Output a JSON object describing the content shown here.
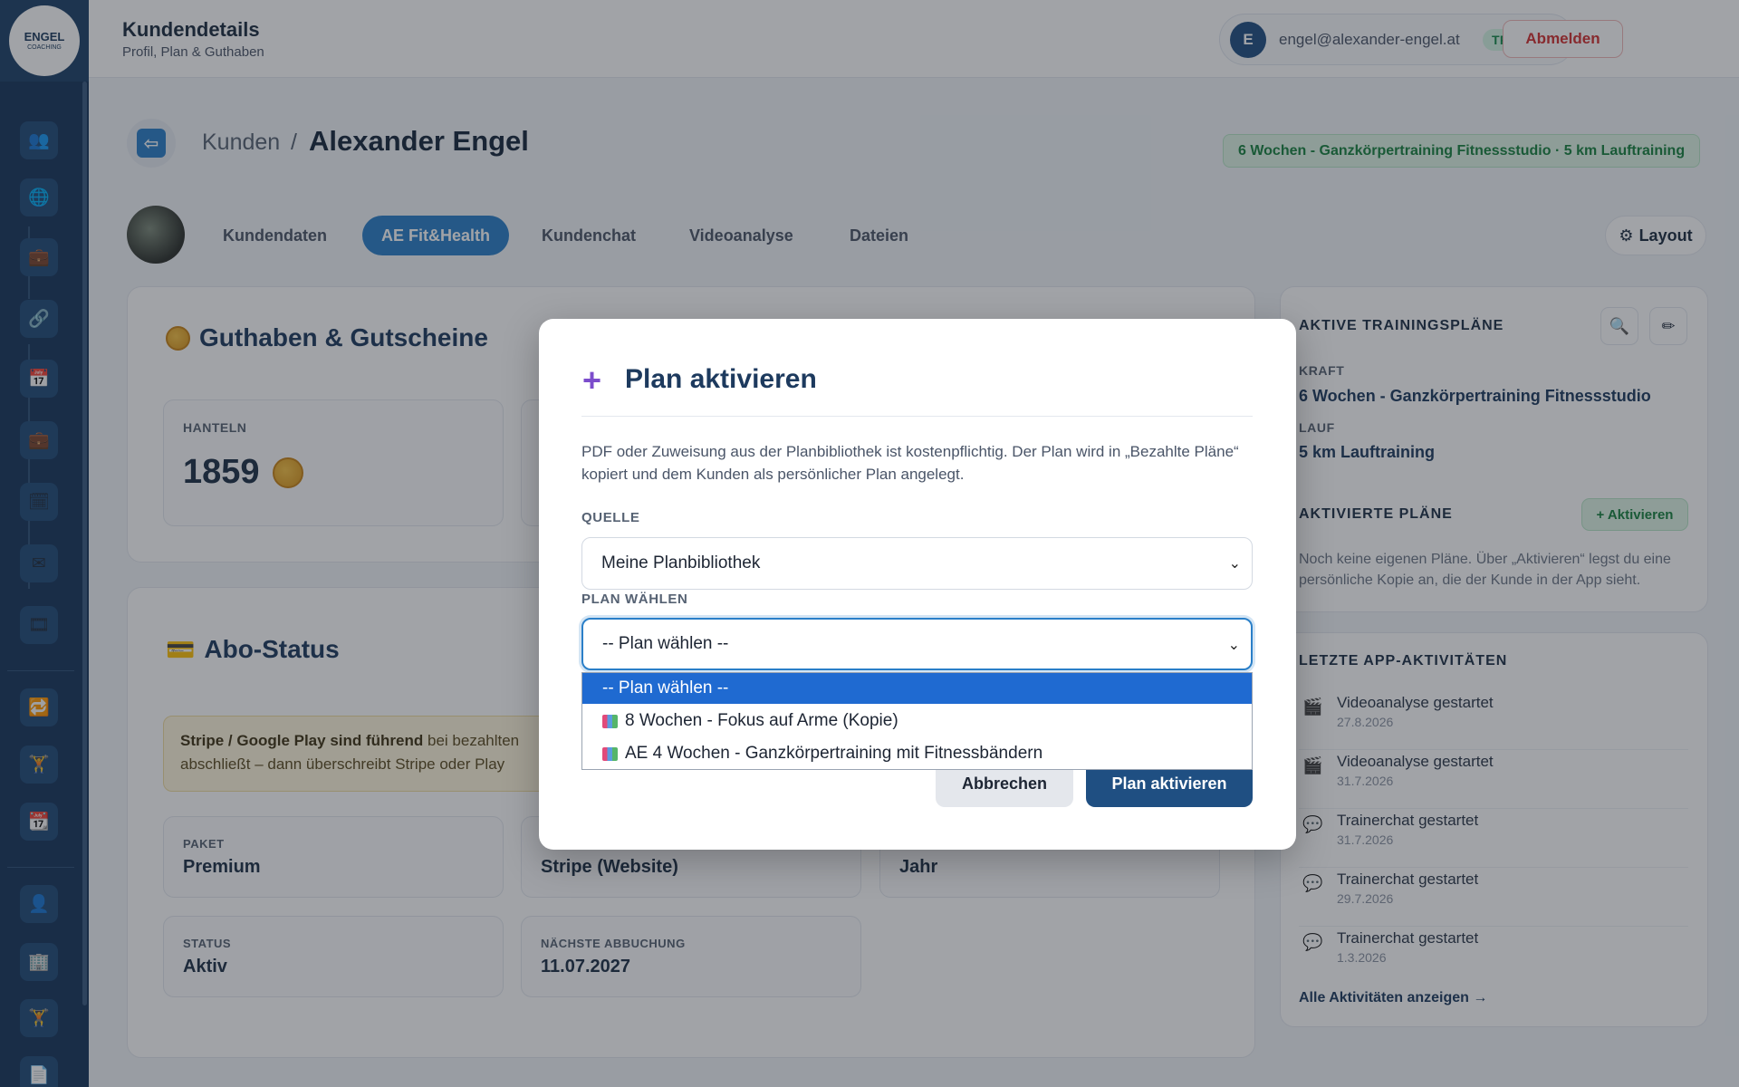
{
  "logo": {
    "line1": "ENGEL",
    "line2": "COACHING"
  },
  "header": {
    "title": "Kundendetails",
    "subtitle": "Profil, Plan & Guthaben",
    "user_initial": "E",
    "user_email": "engel@alexander-engel.at",
    "role_badge": "TRAINER",
    "logout_label": "Abmelden"
  },
  "breadcrumb": {
    "parent": "Kunden",
    "separator": "/",
    "current": "Alexander Engel"
  },
  "active_plan_pill": "6 Wochen - Ganzkörpertraining Fitnessstudio · 5 km Lauftraining",
  "tabs": [
    {
      "label": "Kundendaten"
    },
    {
      "label": "AE Fit&Health",
      "active": true
    },
    {
      "label": "Kundenchat"
    },
    {
      "label": "Videoanalyse"
    },
    {
      "label": "Dateien"
    }
  ],
  "layout_btn": "Layout",
  "credits": {
    "title": "Guthaben & Gutscheine",
    "box_label": "HANTELN",
    "box_value": "1859"
  },
  "abo": {
    "title": "Abo-Status",
    "note_bold": "Stripe / Google Play sind führend",
    "note_line1": "bei bezahlten",
    "note_line2": "abschließt – dann überschreibt Stripe oder Play",
    "paket_label": "PAKET",
    "paket_value": "Premium",
    "quelle_value": "Stripe (Website)",
    "intervall_value": "Jahr",
    "status_label": "STATUS",
    "status_value": "Aktiv",
    "next_label": "NÄCHSTE ABBUCHUNG",
    "next_value": "11.07.2027"
  },
  "right": {
    "active_plans_title": "AKTIVE TRAININGSPLÄNE",
    "kraft_label": "KRAFT",
    "kraft_value": "6 Wochen - Ganzkörpertraining Fitnessstudio",
    "lauf_label": "LAUF",
    "lauf_value": "5 km Lauftraining",
    "activated_title": "AKTIVIERTE PLÄNE",
    "activate_btn": "+ Aktivieren",
    "activated_text": "Noch keine eigenen Pläne. Über „Aktivieren“ legst du eine persönliche Kopie an, die der Kunde in der App sieht.",
    "activities_title": "LETZTE APP-AKTIVITÄTEN",
    "activities": [
      {
        "name": "Videoanalyse gestartet",
        "date": "27.8.2026",
        "icon": "clapper-icon"
      },
      {
        "name": "Videoanalyse gestartet",
        "date": "31.7.2026",
        "icon": "clapper-icon"
      },
      {
        "name": "Trainerchat gestartet",
        "date": "31.7.2026",
        "icon": "chat-icon"
      },
      {
        "name": "Trainerchat gestartet",
        "date": "29.7.2026",
        "icon": "chat-icon"
      },
      {
        "name": "Trainerchat gestartet",
        "date": "1.3.2026",
        "icon": "chat-icon"
      }
    ],
    "all_activities": "Alle Aktivitäten anzeigen →"
  },
  "modal": {
    "title": "Plan aktivieren",
    "description": "PDF oder Zuweisung aus der Planbibliothek ist kostenpflichtig. Der Plan wird in „Bezahlte Pläne“ kopiert und dem Kunden als persönlicher Plan angelegt.",
    "source_label": "QUELLE",
    "source_value": "Meine Planbibliothek",
    "plan_label": "PLAN WÄHLEN",
    "plan_value": "-- Plan wählen --",
    "options": [
      "-- Plan wählen --",
      "8 Wochen - Fokus auf Arme (Kopie)",
      "AE 4 Wochen - Ganzkörpertraining mit Fitnessbändern"
    ],
    "cancel_label": "Abbrechen",
    "submit_label": "Plan aktivieren"
  },
  "colors": {
    "primary": "#1f4f82",
    "accent": "#2a7fc8",
    "sidebar": "#16355a",
    "success": "#17813f",
    "danger": "#d32f2f"
  }
}
